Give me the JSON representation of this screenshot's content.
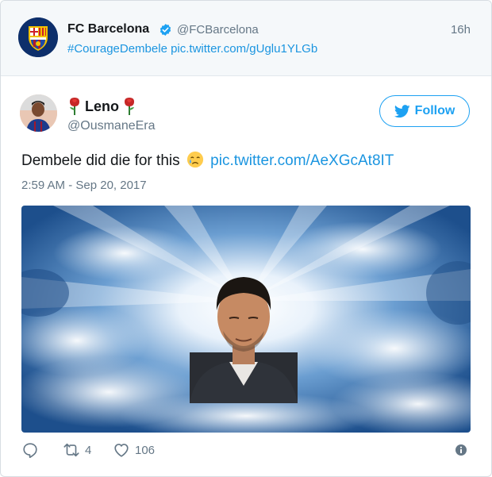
{
  "parent_tweet": {
    "name": "FC Barcelona",
    "handle": "@FCBarcelona",
    "time": "16h",
    "hashtag": "#CourageDembele",
    "link": "pic.twitter.com/gUglu1YLGb"
  },
  "tweet": {
    "display_name": "Leno",
    "handle": "@OusmaneEra",
    "follow_label": "Follow",
    "text": "Dembele did die for this",
    "link": "pic.twitter.com/AeXGcAt8IT",
    "timestamp": "2:59 AM - Sep 20, 2017"
  },
  "actions": {
    "reply_icon": "reply-icon",
    "retweet_icon": "retweet-icon",
    "retweet_count": "4",
    "like_icon": "heart-icon",
    "like_count": "106",
    "info_icon": "info-icon"
  },
  "colors": {
    "accent": "#1da1f2",
    "link": "#1b95e0",
    "muted": "#657786",
    "text": "#14171a",
    "parent_bg": "#f5f8fa"
  }
}
